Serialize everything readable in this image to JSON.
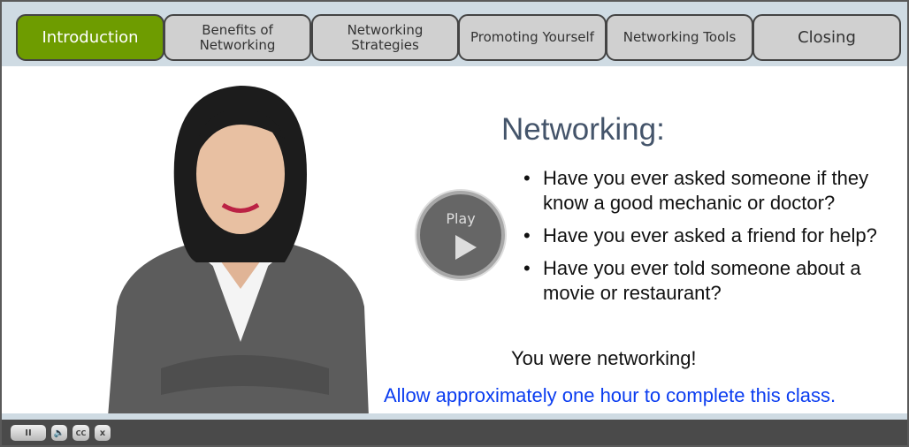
{
  "tabs": [
    {
      "label": "Introduction",
      "active": true
    },
    {
      "label": "Benefits of Networking",
      "active": false
    },
    {
      "label": "Networking Strategies",
      "active": false
    },
    {
      "label": "Promoting Yourself",
      "active": false
    },
    {
      "label": "Networking Tools",
      "active": false
    },
    {
      "label": "Closing",
      "active": false
    }
  ],
  "slide": {
    "title": "Networking:",
    "bullets": [
      "Have you ever asked someone if they know a good mechanic or doctor?",
      "Have you ever asked a friend for help?",
      "Have you ever told someone about a movie or restaurant?"
    ],
    "conclusion": "You were networking!",
    "note": "Allow approximately one hour to complete this class.",
    "play_label": "Play"
  },
  "controls": {
    "pause": "II",
    "cc": "CC",
    "close": "x",
    "icons": [
      "pause-icon",
      "volume-icon",
      "closed-captions-icon",
      "close-icon"
    ]
  },
  "colors": {
    "active_tab": "#6e9c00",
    "tab": "#d0d0d0",
    "header": "#cfdbe3",
    "title": "#44546a",
    "note": "#0a3cf0",
    "control_bar": "#4a4a4a"
  }
}
